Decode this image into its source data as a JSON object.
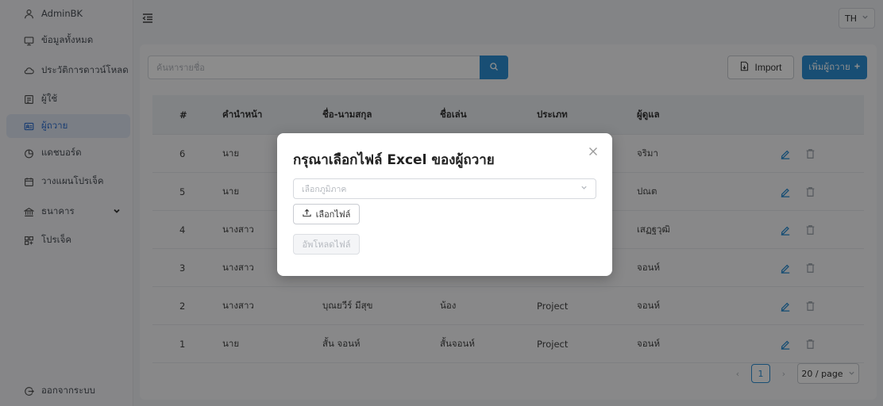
{
  "sidebar": {
    "items": [
      {
        "label": "AdminBK",
        "icon": "user-icon"
      },
      {
        "label": "ข้อมูลทั้งหมด",
        "icon": "monitor-icon"
      },
      {
        "label": "ประวัติการดาวน์โหลด",
        "icon": "cloud-icon"
      },
      {
        "label": "ผู้ใช้",
        "icon": "user-card-icon"
      },
      {
        "label": "ผู้ถวาย",
        "icon": "id-card-icon",
        "active": true
      },
      {
        "label": "แดชบอร์ด",
        "icon": "chart-icon"
      },
      {
        "label": "วางแผนโปรเจ็ค",
        "icon": "calendar-icon"
      },
      {
        "label": "ธนาคาร",
        "icon": "bank-icon"
      },
      {
        "label": "โปรเจ็ค",
        "icon": "project-icon"
      }
    ],
    "logout_label": "ออกจากระบบ"
  },
  "topbar": {
    "language": "TH"
  },
  "search": {
    "placeholder": "ค้นหารายชื่อ"
  },
  "toolbar": {
    "import_label": "Import",
    "add_label": "เพิ่มผู้ถวาย"
  },
  "table": {
    "headers": [
      "#",
      "คำนำหน้า",
      "ชื่อ-นามสกุล",
      "ชื่อเล่น",
      "ประเภท",
      "ผู้ดูแล"
    ],
    "rows": [
      {
        "no": "6",
        "prefix": "นาย",
        "name": "",
        "nickname": "",
        "type": "",
        "caretaker": "จริมา"
      },
      {
        "no": "5",
        "prefix": "นาย",
        "name": "",
        "nickname": "",
        "type": "",
        "caretaker": "ปณต"
      },
      {
        "no": "4",
        "prefix": "นางสาว",
        "name": "",
        "nickname": "",
        "type": "",
        "caretaker": "เสฏฐวุฒิ"
      },
      {
        "no": "3",
        "prefix": "นางสาว",
        "name": "",
        "nickname": "",
        "type": "",
        "caretaker": "จอนห์"
      },
      {
        "no": "2",
        "prefix": "นางสาว",
        "name": "บุณยวีร์ มีสุข",
        "nickname": "น้อง",
        "type": "Project",
        "caretaker": "จอนห์"
      },
      {
        "no": "1",
        "prefix": "นาย",
        "name": "สั้น จอนห์",
        "nickname": "สั้นจอนห์",
        "type": "Project",
        "caretaker": "จอนห์"
      }
    ]
  },
  "pagination": {
    "current_page": "1",
    "page_size": "20 / page"
  },
  "modal": {
    "title": "กรุณาเลือกไฟล์ Excel ของผู้ถวาย",
    "region_placeholder": "เลือกภูมิภาค",
    "pick_file_label": "เลือกไฟล์",
    "upload_label": "อัพโหลดไฟล์"
  },
  "colors": {
    "accent": "#2d8fd3",
    "active_bg": "#dfe6f3"
  }
}
